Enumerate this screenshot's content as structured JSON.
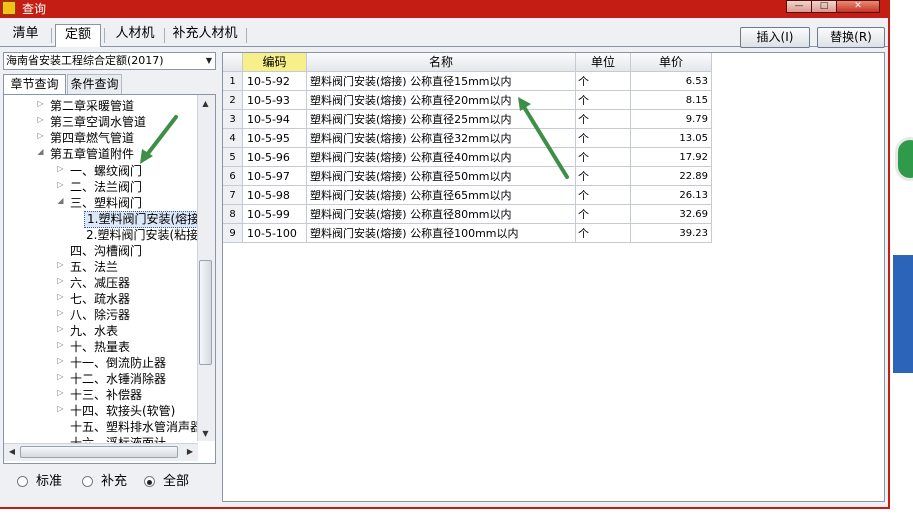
{
  "window": {
    "title": "查询",
    "min_glyph": "—",
    "max_glyph": "□",
    "close_glyph": "✕"
  },
  "tabs": [
    {
      "label": "清单"
    },
    {
      "label": "定额"
    },
    {
      "label": "人材机"
    },
    {
      "label": "补充人材机"
    }
  ],
  "toolbar": {
    "insert_label": "插入(I)",
    "replace_label": "替换(R)"
  },
  "left": {
    "quota_select": "海南省安装工程综合定额(2017)",
    "subtabs": [
      {
        "label": "章节查询"
      },
      {
        "label": "条件查询"
      }
    ],
    "tree": [
      {
        "label": "第二章采暖管道"
      },
      {
        "label": "第三章空调水管道"
      },
      {
        "label": "第四章燃气管道"
      },
      {
        "label": "第五章管道附件"
      },
      {
        "label": "一、螺纹阀门"
      },
      {
        "label": "二、法兰阀门"
      },
      {
        "label": "三、塑料阀门"
      },
      {
        "label": "1.塑料阀门安装(熔接"
      },
      {
        "label": "2.塑料阀门安装(粘接"
      },
      {
        "label": "四、沟槽阀门"
      },
      {
        "label": "五、法兰"
      },
      {
        "label": "六、减压器"
      },
      {
        "label": "七、疏水器"
      },
      {
        "label": "八、除污器"
      },
      {
        "label": "九、水表"
      },
      {
        "label": "十、热量表"
      },
      {
        "label": "十一、倒流防止器"
      },
      {
        "label": "十二、水锤消除器"
      },
      {
        "label": "十三、补偿器"
      },
      {
        "label": "十四、软接头(软管)"
      },
      {
        "label": "十五、塑料排水管消声器"
      },
      {
        "label": "十六、浮标液面计"
      }
    ],
    "radios": [
      {
        "label": "标准"
      },
      {
        "label": "补充"
      },
      {
        "label": "全部"
      }
    ],
    "selected_radio": "全部"
  },
  "grid": {
    "headers": [
      {
        "label": "编码"
      },
      {
        "label": "名称"
      },
      {
        "label": "单位"
      },
      {
        "label": "单价"
      }
    ],
    "rows": [
      {
        "no": "1",
        "code": "10-5-92",
        "name": "塑料阀门安装(熔接) 公称直径15mm以内",
        "unit": "个",
        "price": "6.53"
      },
      {
        "no": "2",
        "code": "10-5-93",
        "name": "塑料阀门安装(熔接) 公称直径20mm以内",
        "unit": "个",
        "price": "8.15"
      },
      {
        "no": "3",
        "code": "10-5-94",
        "name": "塑料阀门安装(熔接) 公称直径25mm以内",
        "unit": "个",
        "price": "9.79"
      },
      {
        "no": "4",
        "code": "10-5-95",
        "name": "塑料阀门安装(熔接) 公称直径32mm以内",
        "unit": "个",
        "price": "13.05"
      },
      {
        "no": "5",
        "code": "10-5-96",
        "name": "塑料阀门安装(熔接) 公称直径40mm以内",
        "unit": "个",
        "price": "17.92"
      },
      {
        "no": "6",
        "code": "10-5-97",
        "name": "塑料阀门安装(熔接) 公称直径50mm以内",
        "unit": "个",
        "price": "22.89"
      },
      {
        "no": "7",
        "code": "10-5-98",
        "name": "塑料阀门安装(熔接) 公称直径65mm以内",
        "unit": "个",
        "price": "26.13"
      },
      {
        "no": "8",
        "code": "10-5-99",
        "name": "塑料阀门安装(熔接) 公称直径80mm以内",
        "unit": "个",
        "price": "32.69"
      },
      {
        "no": "9",
        "code": "10-5-100",
        "name": "塑料阀门安装(熔接) 公称直径100mm以内",
        "unit": "个",
        "price": "39.23"
      }
    ]
  },
  "colors": {
    "titlebar": "#c41d14",
    "window_bg": "#eef0f4",
    "code_header": "#f7f08a",
    "annotation_arrow": "#3d8f47",
    "selected_node": "#dce7f7"
  }
}
